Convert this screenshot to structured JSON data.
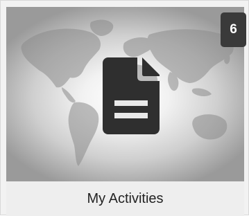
{
  "tile": {
    "label": "My Activities",
    "count_badge": "6",
    "icon": "document-icon",
    "background_image": "world-map",
    "colors": {
      "icon": "#2f2f2f",
      "badge_bg": "#3a3a3a",
      "badge_text": "#ffffff",
      "label_text": "#222222"
    }
  }
}
